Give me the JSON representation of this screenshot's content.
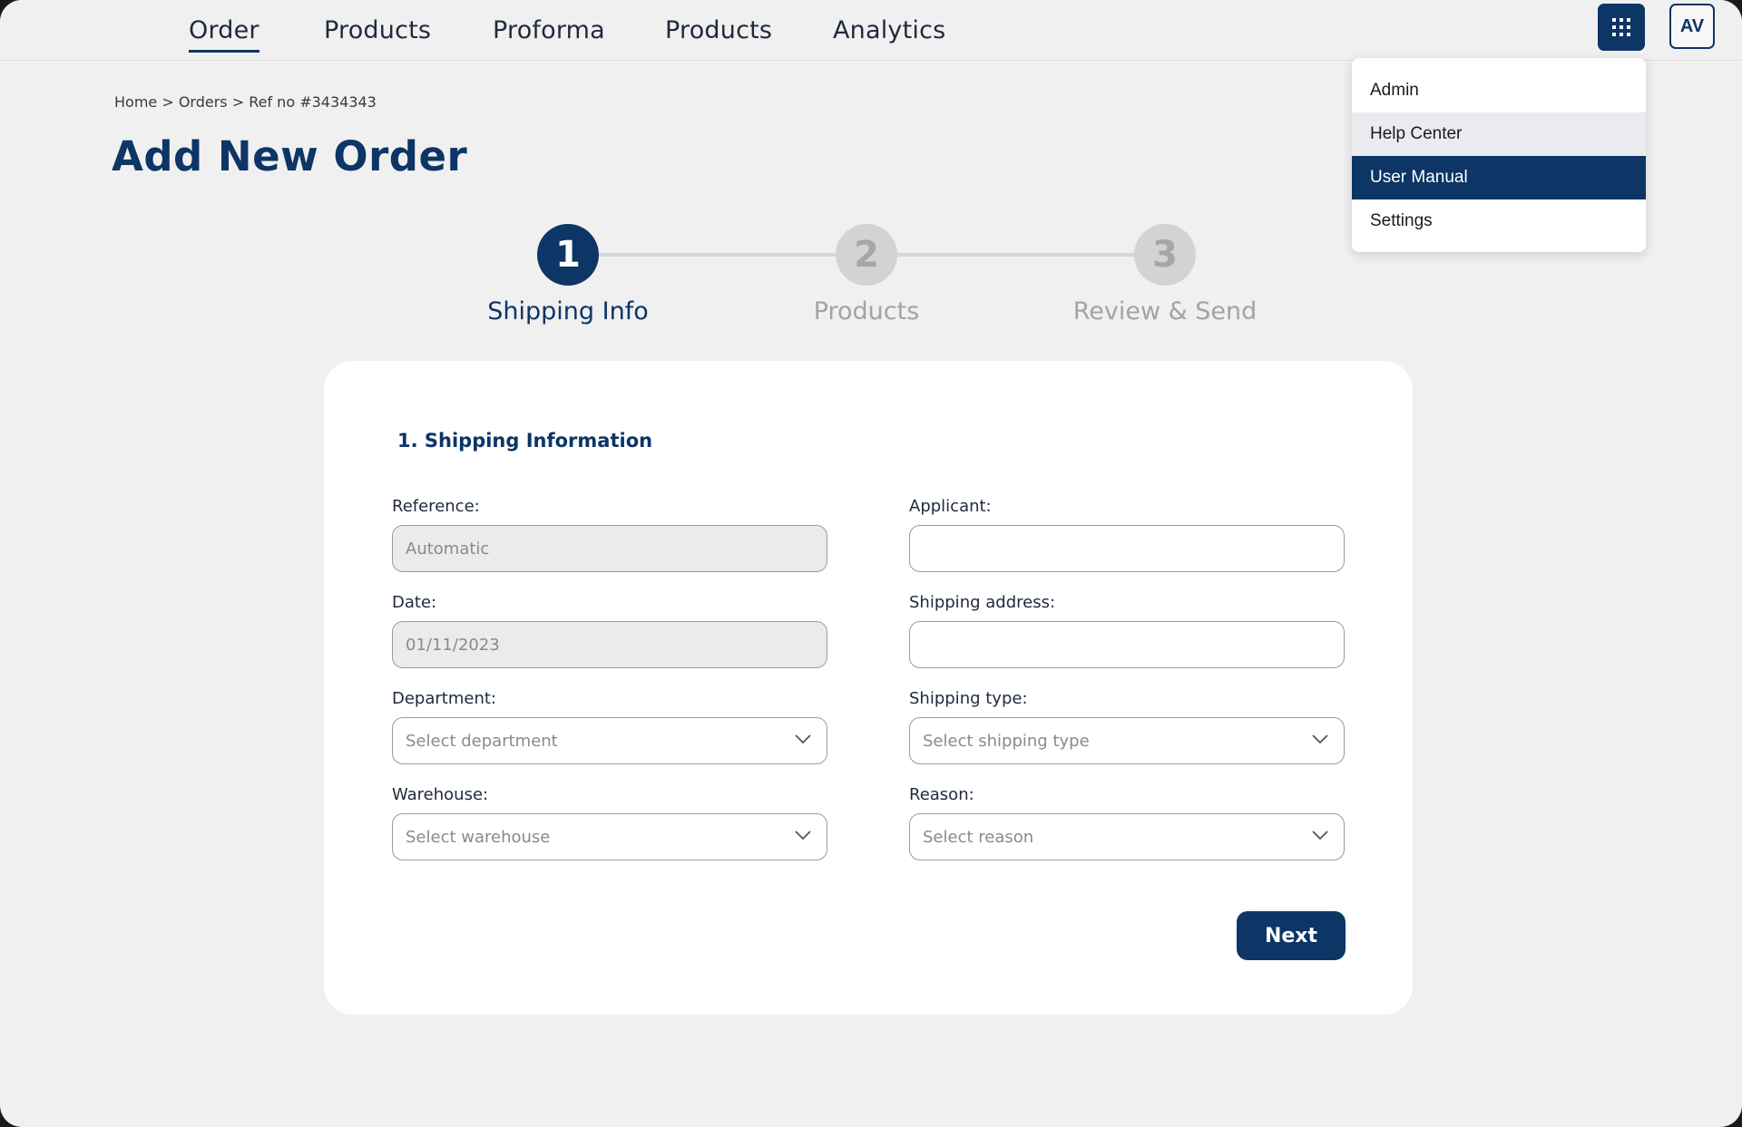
{
  "nav": {
    "items": [
      {
        "label": "Order",
        "active": true
      },
      {
        "label": "Products"
      },
      {
        "label": "Proforma"
      },
      {
        "label": "Products"
      },
      {
        "label": "Analytics"
      }
    ],
    "apps_icon": "grid-icon",
    "avatar": "AV"
  },
  "menu": {
    "items": [
      {
        "label": "Admin"
      },
      {
        "label": "Help Center",
        "state": "hover"
      },
      {
        "label": "User Manual",
        "state": "selected"
      },
      {
        "label": "Settings"
      }
    ]
  },
  "breadcrumb": "Home > Orders > Ref no #3434343",
  "page_title": "Add New Order",
  "stepper": {
    "steps": [
      {
        "number": "1",
        "label": "Shipping Info",
        "active": true
      },
      {
        "number": "2",
        "label": "Products",
        "active": false
      },
      {
        "number": "3",
        "label": "Review & Send",
        "active": false
      }
    ]
  },
  "form": {
    "section_title": "1. Shipping Information",
    "reference": {
      "label": "Reference:",
      "value": "Automatic"
    },
    "date": {
      "label": "Date:",
      "value": "01/11/2023"
    },
    "department": {
      "label": "Department:",
      "placeholder": "Select department"
    },
    "warehouse": {
      "label": "Warehouse:",
      "placeholder": "Select warehouse"
    },
    "applicant": {
      "label": "Applicant:",
      "value": ""
    },
    "shipping_address": {
      "label": "Shipping address:",
      "value": ""
    },
    "shipping_type": {
      "label": "Shipping type:",
      "placeholder": "Select shipping type"
    },
    "reason": {
      "label": "Reason:",
      "placeholder": "Select reason"
    },
    "next_label": "Next"
  },
  "colors": {
    "primary": "#0d3566",
    "background": "#f0f0f0",
    "card": "#ffffff",
    "inactive_step": "#d3d3d3"
  }
}
